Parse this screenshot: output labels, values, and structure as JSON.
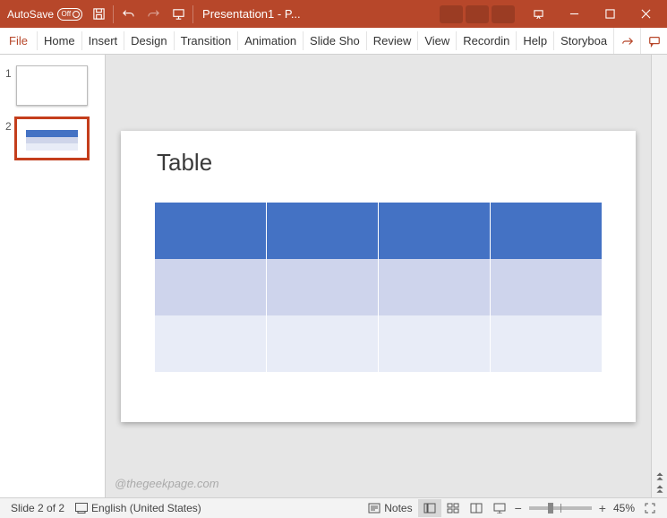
{
  "titlebar": {
    "autosave_label": "AutoSave",
    "autosave_state": "Off",
    "title": "Presentation1 - P..."
  },
  "ribbon": {
    "tabs": [
      "File",
      "Home",
      "Insert",
      "Design",
      "Transition",
      "Animation",
      "Slide Sho",
      "Review",
      "View",
      "Recordin",
      "Help",
      "Storyboa"
    ]
  },
  "thumbnails": {
    "items": [
      {
        "num": "1",
        "active": false
      },
      {
        "num": "2",
        "active": true
      }
    ]
  },
  "slide": {
    "title": "Table"
  },
  "status": {
    "slide_info": "Slide 2 of 2",
    "language": "English (United States)",
    "notes": "Notes",
    "zoom": "45%"
  },
  "watermark": "@thegeekpage.com"
}
